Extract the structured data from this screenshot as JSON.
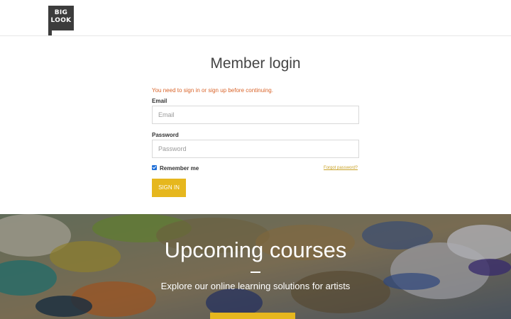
{
  "header": {
    "logo_line1": "BIG",
    "logo_line2": "LOOK"
  },
  "login": {
    "title": "Member login",
    "notice": "You need to sign in or sign up before continuing.",
    "email_label": "Email",
    "email_placeholder": "Email",
    "password_label": "Password",
    "password_placeholder": "Password",
    "remember_label": "Remember me",
    "remember_checked": true,
    "forgot_link": "Forgot password?",
    "signin_label": "SIGN IN"
  },
  "hero": {
    "title": "Upcoming courses",
    "subtitle": "Explore our online learning solutions for artists"
  },
  "colors": {
    "accent": "#e6b71e",
    "notice": "#d9642a",
    "checkbox": "#1f6fd8"
  }
}
